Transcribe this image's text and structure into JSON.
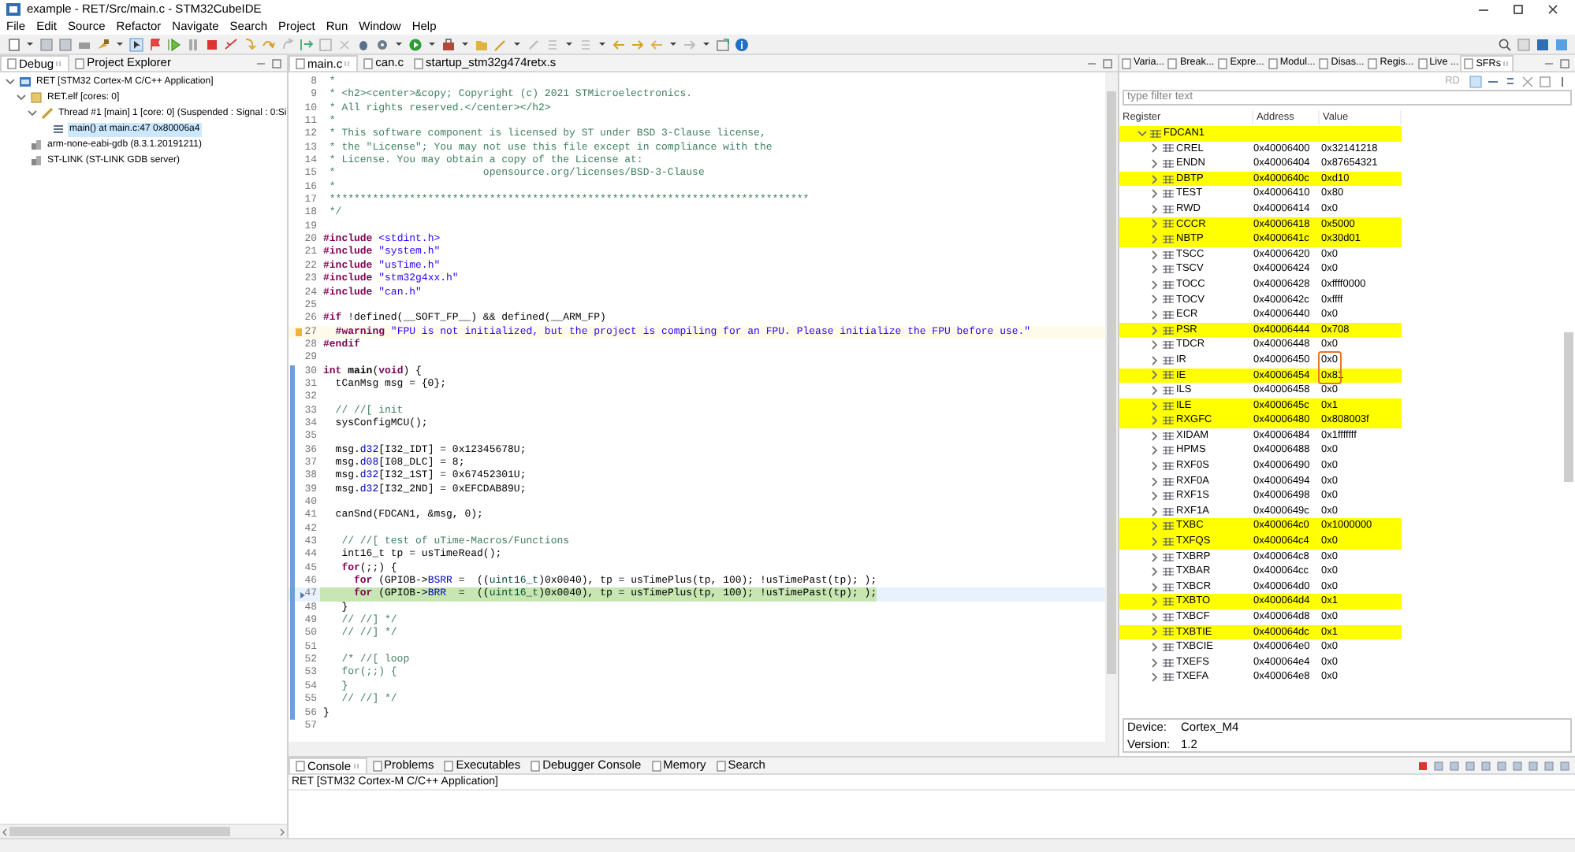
{
  "window": {
    "title": "example - RET/Src/main.c - STM32CubeIDE"
  },
  "menu": [
    "File",
    "Edit",
    "Source",
    "Refactor",
    "Navigate",
    "Search",
    "Project",
    "Run",
    "Window",
    "Help"
  ],
  "debug_view": {
    "tabs": [
      {
        "label": "Debug",
        "selected": true
      },
      {
        "label": "Project Explorer",
        "selected": false
      }
    ],
    "tree": [
      {
        "label": "RET [STM32 Cortex-M C/C++ Application]",
        "kind": "launch",
        "expanded": true,
        "selected": false,
        "children": [
          {
            "label": "RET.elf [cores: 0]",
            "kind": "process",
            "expanded": true,
            "selected": false,
            "children": [
              {
                "label": "Thread #1 [main] 1 [core: 0] (Suspended : Signal : 0:Si",
                "kind": "thread",
                "expanded": true,
                "selected": false,
                "children": [
                  {
                    "label": "main() at main.c:47 0x80006a4",
                    "kind": "frame",
                    "selected": true
                  }
                ]
              }
            ]
          },
          {
            "label": "arm-none-eabi-gdb (8.3.1.20191211)",
            "kind": "tool",
            "selected": false
          },
          {
            "label": "ST-LINK (ST-LINK GDB server)",
            "kind": "tool",
            "selected": false
          }
        ]
      }
    ]
  },
  "editor": {
    "tabs": [
      {
        "label": "main.c",
        "selected": true
      },
      {
        "label": "can.c",
        "selected": false
      },
      {
        "label": "startup_stm32g474retx.s",
        "selected": false
      }
    ],
    "lines": [
      {
        "number": "8",
        "kind": "normal",
        "segments": [
          {
            "kind": "comment",
            "text": " *"
          }
        ]
      },
      {
        "number": "9",
        "kind": "normal",
        "segments": [
          {
            "kind": "comment",
            "text": " * <h2><center>&copy; Copyright (c) 2021 STMicroelectronics."
          }
        ]
      },
      {
        "number": "10",
        "kind": "normal",
        "segments": [
          {
            "kind": "comment",
            "text": " * All rights reserved.</center></h2>"
          }
        ]
      },
      {
        "number": "11",
        "kind": "normal",
        "segments": [
          {
            "kind": "comment",
            "text": " *"
          }
        ]
      },
      {
        "number": "12",
        "kind": "normal",
        "segments": [
          {
            "kind": "comment",
            "text": " * This software component is licensed by ST under BSD 3-Clause license,"
          }
        ]
      },
      {
        "number": "13",
        "kind": "normal",
        "segments": [
          {
            "kind": "comment",
            "text": " * the \"License\"; You may not use this file except in compliance with the"
          }
        ]
      },
      {
        "number": "14",
        "kind": "normal",
        "segments": [
          {
            "kind": "comment",
            "text": " * License. You may obtain a copy of the License at:"
          }
        ]
      },
      {
        "number": "15",
        "kind": "normal",
        "segments": [
          {
            "kind": "comment",
            "text": " *                        opensource.org/licenses/BSD-3-Clause"
          }
        ]
      },
      {
        "number": "16",
        "kind": "normal",
        "segments": [
          {
            "kind": "comment",
            "text": " *"
          }
        ]
      },
      {
        "number": "17",
        "kind": "normal",
        "segments": [
          {
            "kind": "comment",
            "text": " ******************************************************************************"
          }
        ]
      },
      {
        "number": "18",
        "kind": "normal",
        "segments": [
          {
            "kind": "comment",
            "text": " */"
          }
        ]
      },
      {
        "number": "19",
        "kind": "normal"
      },
      {
        "number": "20",
        "kind": "normal",
        "segments": [
          {
            "kind": "keyword",
            "text": "#include"
          },
          {
            "kind": "string",
            "text": " <stdint.h>"
          }
        ]
      },
      {
        "number": "21",
        "kind": "normal",
        "segments": [
          {
            "kind": "keyword",
            "text": "#include"
          },
          {
            "kind": "string",
            "text": " \"system.h\""
          }
        ]
      },
      {
        "number": "22",
        "kind": "normal",
        "segments": [
          {
            "kind": "keyword",
            "text": "#include"
          },
          {
            "kind": "string",
            "text": " \"usTime.h\""
          }
        ]
      },
      {
        "number": "23",
        "kind": "normal",
        "segments": [
          {
            "kind": "keyword",
            "text": "#include"
          },
          {
            "kind": "string",
            "text": " \"stm32g4xx.h\""
          }
        ]
      },
      {
        "number": "24",
        "kind": "normal",
        "segments": [
          {
            "kind": "keyword",
            "text": "#include"
          },
          {
            "kind": "string",
            "text": " \"can.h\""
          }
        ]
      },
      {
        "number": "25",
        "kind": "normal"
      },
      {
        "number": "26",
        "kind": "normal",
        "segments": [
          {
            "kind": "keyword",
            "text": "#if"
          },
          {
            "kind": "plain",
            "text": " !defined(__SOFT_FP__) && defined(__ARM_FP)"
          }
        ]
      },
      {
        "number": "27",
        "kind": "warning",
        "segments": [
          {
            "kind": "keyword",
            "text": "  #warning"
          },
          {
            "kind": "string",
            "text": " \"FPU is not initialized, but the project is compiling for an FPU. Please initialize the FPU before use.\""
          }
        ]
      },
      {
        "number": "28",
        "kind": "normal",
        "segments": [
          {
            "kind": "keyword",
            "text": "#endif"
          }
        ]
      },
      {
        "number": "29",
        "kind": "normal"
      },
      {
        "number": "30",
        "kind": "changed",
        "segments": [
          {
            "kind": "keyword",
            "text": "int"
          },
          {
            "kind": "bold",
            "text": " main"
          },
          {
            "kind": "plain",
            "text": "("
          },
          {
            "kind": "keyword",
            "text": "void"
          },
          {
            "kind": "plain",
            "text": ") {"
          }
        ]
      },
      {
        "number": "31",
        "kind": "changed",
        "segments": [
          {
            "kind": "plain",
            "text": "  tCanMsg msg = {0};"
          }
        ]
      },
      {
        "number": "32",
        "kind": "changed"
      },
      {
        "number": "33",
        "kind": "changed",
        "segments": [
          {
            "kind": "comment",
            "text": "  // //[ init"
          }
        ]
      },
      {
        "number": "34",
        "kind": "changed",
        "segments": [
          {
            "kind": "plain",
            "text": "  sysConfigMCU();"
          }
        ]
      },
      {
        "number": "35",
        "kind": "changed"
      },
      {
        "number": "36",
        "kind": "changed",
        "segments": [
          {
            "kind": "plain",
            "text": "  msg."
          },
          {
            "kind": "field",
            "text": "d32"
          },
          {
            "kind": "plain",
            "text": "[I32_IDT] = 0x12345678U;"
          }
        ]
      },
      {
        "number": "37",
        "kind": "changed",
        "segments": [
          {
            "kind": "plain",
            "text": "  msg."
          },
          {
            "kind": "field",
            "text": "d08"
          },
          {
            "kind": "plain",
            "text": "[I08_DLC] = 8;"
          }
        ]
      },
      {
        "number": "38",
        "kind": "changed",
        "segments": [
          {
            "kind": "plain",
            "text": "  msg."
          },
          {
            "kind": "field",
            "text": "d32"
          },
          {
            "kind": "plain",
            "text": "[I32_1ST] = 0x67452301U;"
          }
        ]
      },
      {
        "number": "39",
        "kind": "changed",
        "segments": [
          {
            "kind": "plain",
            "text": "  msg."
          },
          {
            "kind": "field",
            "text": "d32"
          },
          {
            "kind": "plain",
            "text": "[I32_2ND] = 0xEFCDAB89U;"
          }
        ]
      },
      {
        "number": "40",
        "kind": "changed"
      },
      {
        "number": "41",
        "kind": "changed",
        "segments": [
          {
            "kind": "plain",
            "text": "  canSnd(FDCAN1, &msg, 0);"
          }
        ]
      },
      {
        "number": "42",
        "kind": "changed"
      },
      {
        "number": "43",
        "kind": "changed",
        "segments": [
          {
            "kind": "comment",
            "text": "   // //[ test of uTime-Macros/Functions"
          }
        ]
      },
      {
        "number": "44",
        "kind": "changed",
        "segments": [
          {
            "kind": "plain",
            "text": "   int16_t tp = usTimeRead();"
          }
        ]
      },
      {
        "number": "45",
        "kind": "changed",
        "segments": [
          {
            "kind": "keyword",
            "text": "   for"
          },
          {
            "kind": "plain",
            "text": "(;;) {"
          }
        ]
      },
      {
        "number": "46",
        "kind": "changed",
        "segments": [
          {
            "kind": "keyword",
            "text": "     for"
          },
          {
            "kind": "plain",
            "text": " (GPIOB->"
          },
          {
            "kind": "field",
            "text": "BSRR"
          },
          {
            "kind": "plain",
            "text": " =  (("
          },
          {
            "kind": "type",
            "text": "uint16_t"
          },
          {
            "kind": "plain",
            "text": ")0x0040), tp = usTimePlus(tp, 100); !usTimePast(tp); );"
          }
        ]
      },
      {
        "number": "47",
        "kind": "current",
        "segments": [
          {
            "kind": "keyword",
            "text": "     for"
          },
          {
            "kind": "plain",
            "text": " (GPIOB->"
          },
          {
            "kind": "field",
            "text": "BRR"
          },
          {
            "kind": "plain",
            "text": "  =  (("
          },
          {
            "kind": "type",
            "text": "uint16_t"
          },
          {
            "kind": "plain",
            "text": ")0x0040), tp = usTimePlus(tp, 100); !usTimePast(tp); );"
          }
        ]
      },
      {
        "number": "48",
        "kind": "changed",
        "segments": [
          {
            "kind": "plain",
            "text": "   }"
          }
        ]
      },
      {
        "number": "49",
        "kind": "changed",
        "segments": [
          {
            "kind": "comment",
            "text": "   // //] */"
          }
        ]
      },
      {
        "number": "50",
        "kind": "changed",
        "segments": [
          {
            "kind": "comment",
            "text": "   // //] */"
          }
        ]
      },
      {
        "number": "51",
        "kind": "changed"
      },
      {
        "number": "52",
        "kind": "changed",
        "segments": [
          {
            "kind": "comment",
            "text": "   /* //[ loop"
          }
        ]
      },
      {
        "number": "53",
        "kind": "changed",
        "segments": [
          {
            "kind": "comment",
            "text": "   for(;;) {"
          }
        ]
      },
      {
        "number": "54",
        "kind": "changed",
        "segments": [
          {
            "kind": "comment",
            "text": "   }"
          }
        ]
      },
      {
        "number": "55",
        "kind": "changed",
        "segments": [
          {
            "kind": "comment",
            "text": "   // //] */"
          }
        ]
      },
      {
        "number": "56",
        "kind": "changed",
        "segments": [
          {
            "kind": "plain",
            "text": "}"
          }
        ]
      },
      {
        "number": "57",
        "kind": "normal"
      }
    ]
  },
  "sfr_view": {
    "tabs": [
      {
        "label": "Varia...",
        "selected": false
      },
      {
        "label": "Break...",
        "selected": false
      },
      {
        "label": "Expre...",
        "selected": false
      },
      {
        "label": "Modul...",
        "selected": false
      },
      {
        "label": "Disas...",
        "selected": false
      },
      {
        "label": "Regis...",
        "selected": false
      },
      {
        "label": "Live ...",
        "selected": false
      },
      {
        "label": "SFRs",
        "selected": true
      }
    ],
    "toolbar_label": "RD",
    "filter": {
      "placeholder": "type filter text"
    },
    "columns": [
      "Register",
      "Address",
      "Value"
    ],
    "registers": [
      {
        "name": "FDCAN1",
        "expanded": true,
        "highlighted": true,
        "children": [
          {
            "name": "CREL",
            "address": "0x40006400",
            "value": "0x32141218",
            "expanded": false,
            "highlighted": false,
            "circled": false
          },
          {
            "name": "ENDN",
            "address": "0x40006404",
            "value": "0x87654321",
            "expanded": false,
            "highlighted": false,
            "circled": false
          },
          {
            "name": "DBTP",
            "address": "0x4000640c",
            "value": "0xd10",
            "expanded": false,
            "highlighted": true,
            "circled": false
          },
          {
            "name": "TEST",
            "address": "0x40006410",
            "value": "0x80",
            "expanded": false,
            "highlighted": false,
            "circled": false
          },
          {
            "name": "RWD",
            "address": "0x40006414",
            "value": "0x0",
            "expanded": false,
            "highlighted": false,
            "circled": false
          },
          {
            "name": "CCCR",
            "address": "0x40006418",
            "value": "0x5000",
            "expanded": false,
            "highlighted": true,
            "circled": false
          },
          {
            "name": "NBTP",
            "address": "0x4000641c",
            "value": "0x30d01",
            "expanded": false,
            "highlighted": true,
            "circled": false
          },
          {
            "name": "TSCC",
            "address": "0x40006420",
            "value": "0x0",
            "expanded": false,
            "highlighted": false,
            "circled": false
          },
          {
            "name": "TSCV",
            "address": "0x40006424",
            "value": "0x0",
            "expanded": false,
            "highlighted": false,
            "circled": false
          },
          {
            "name": "TOCC",
            "address": "0x40006428",
            "value": "0xffff0000",
            "expanded": false,
            "highlighted": false,
            "circled": false
          },
          {
            "name": "TOCV",
            "address": "0x4000642c",
            "value": "0xffff",
            "expanded": false,
            "highlighted": false,
            "circled": false
          },
          {
            "name": "ECR",
            "address": "0x40006440",
            "value": "0x0",
            "expanded": false,
            "highlighted": false,
            "circled": false
          },
          {
            "name": "PSR",
            "address": "0x40006444",
            "value": "0x708",
            "expanded": false,
            "highlighted": true,
            "circled": false
          },
          {
            "name": "TDCR",
            "address": "0x40006448",
            "value": "0x0",
            "expanded": false,
            "highlighted": false,
            "circled": false
          },
          {
            "name": "IR",
            "address": "0x40006450",
            "value": "0x0",
            "expanded": false,
            "highlighted": false,
            "circled": true
          },
          {
            "name": "IE",
            "address": "0x40006454",
            "value": "0x81",
            "expanded": false,
            "highlighted": true,
            "circled": true
          },
          {
            "name": "ILS",
            "address": "0x40006458",
            "value": "0x0",
            "expanded": false,
            "highlighted": false,
            "circled": false
          },
          {
            "name": "ILE",
            "address": "0x4000645c",
            "value": "0x1",
            "expanded": false,
            "highlighted": true,
            "circled": false
          },
          {
            "name": "RXGFC",
            "address": "0x40006480",
            "value": "0x808003f",
            "expanded": false,
            "highlighted": true,
            "circled": false
          },
          {
            "name": "XIDAM",
            "address": "0x40006484",
            "value": "0x1fffffff",
            "expanded": false,
            "highlighted": false,
            "circled": false
          },
          {
            "name": "HPMS",
            "address": "0x40006488",
            "value": "0x0",
            "expanded": false,
            "highlighted": false,
            "circled": false
          },
          {
            "name": "RXF0S",
            "address": "0x40006490",
            "value": "0x0",
            "expanded": false,
            "highlighted": false,
            "circled": false
          },
          {
            "name": "RXF0A",
            "address": "0x40006494",
            "value": "0x0",
            "expanded": false,
            "highlighted": false,
            "circled": false
          },
          {
            "name": "RXF1S",
            "address": "0x40006498",
            "value": "0x0",
            "expanded": false,
            "highlighted": false,
            "circled": false
          },
          {
            "name": "RXF1A",
            "address": "0x4000649c",
            "value": "0x0",
            "expanded": false,
            "highlighted": false,
            "circled": false
          },
          {
            "name": "TXBC",
            "address": "0x400064c0",
            "value": "0x1000000",
            "expanded": false,
            "highlighted": true,
            "circled": false
          },
          {
            "name": "TXFQS",
            "address": "0x400064c4",
            "value": "0x0",
            "expanded": false,
            "highlighted": true,
            "circled": false
          },
          {
            "name": "TXBRP",
            "address": "0x400064c8",
            "value": "0x0",
            "expanded": false,
            "highlighted": false,
            "circled": false
          },
          {
            "name": "TXBAR",
            "address": "0x400064cc",
            "value": "0x0",
            "expanded": false,
            "highlighted": false,
            "circled": false
          },
          {
            "name": "TXBCR",
            "address": "0x400064d0",
            "value": "0x0",
            "expanded": false,
            "highlighted": false,
            "circled": false
          },
          {
            "name": "TXBTO",
            "address": "0x400064d4",
            "value": "0x1",
            "expanded": false,
            "highlighted": true,
            "circled": false
          },
          {
            "name": "TXBCF",
            "address": "0x400064d8",
            "value": "0x0",
            "expanded": false,
            "highlighted": false,
            "circled": false
          },
          {
            "name": "TXBTIE",
            "address": "0x400064dc",
            "value": "0x1",
            "expanded": false,
            "highlighted": true,
            "circled": false
          },
          {
            "name": "TXBCIE",
            "address": "0x400064e0",
            "value": "0x0",
            "expanded": false,
            "highlighted": false,
            "circled": false
          },
          {
            "name": "TXEFS",
            "address": "0x400064e4",
            "value": "0x0",
            "expanded": false,
            "highlighted": false,
            "circled": false
          },
          {
            "name": "TXEFA",
            "address": "0x400064e8",
            "value": "0x0",
            "expanded": false,
            "highlighted": false,
            "circled": false
          }
        ]
      }
    ],
    "details": [
      {
        "label": "Device:",
        "value": "Cortex_M4"
      },
      {
        "label": "Version:",
        "value": "1.2"
      }
    ]
  },
  "console": {
    "tabs": [
      {
        "label": "Console",
        "selected": true
      },
      {
        "label": "Problems",
        "selected": false
      },
      {
        "label": "Executables",
        "selected": false
      },
      {
        "label": "Debugger Console",
        "selected": false
      },
      {
        "label": "Memory",
        "selected": false
      },
      {
        "label": "Search",
        "selected": false
      }
    ],
    "text": "RET [STM32 Cortex-M C/C++ Application]"
  }
}
